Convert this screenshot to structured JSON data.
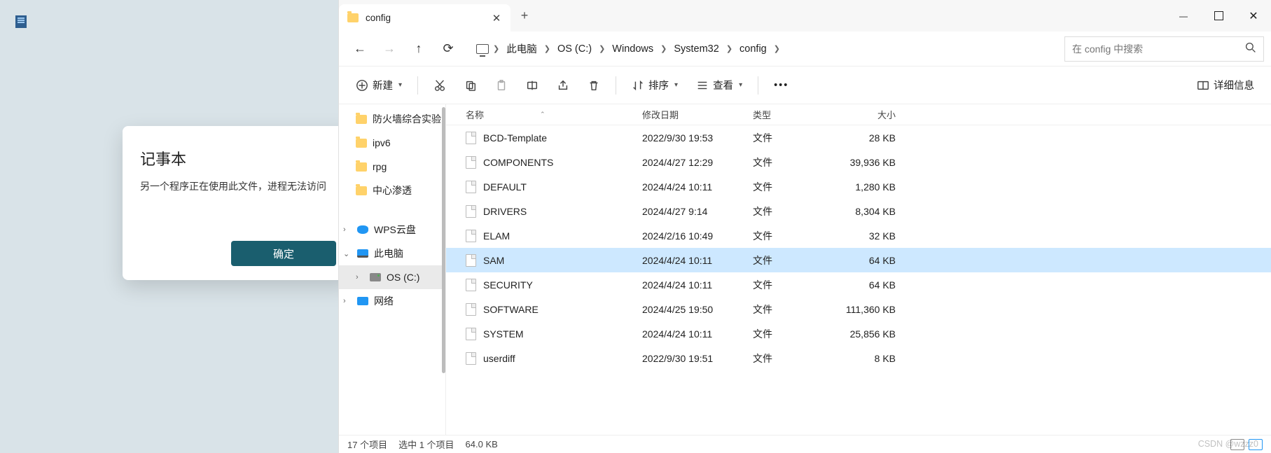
{
  "dialog": {
    "title": "记事本",
    "message": "另一个程序正在使用此文件，进程无法访问",
    "ok": "确定"
  },
  "tab": {
    "title": "config"
  },
  "breadcrumb": {
    "pc": "此电脑",
    "drive": "OS (C:)",
    "p1": "Windows",
    "p2": "System32",
    "p3": "config"
  },
  "search": {
    "placeholder": "在 config 中搜索"
  },
  "toolbar": {
    "new": "新建",
    "sort": "排序",
    "view": "查看",
    "details": "详细信息"
  },
  "nav": {
    "i0": "防火墙综合实验",
    "i1": "ipv6",
    "i2": "rpg",
    "i3": "中心渗透",
    "wps": "WPS云盘",
    "pc": "此电脑",
    "drive": "OS (C:)",
    "net": "网络"
  },
  "cols": {
    "name": "名称",
    "date": "修改日期",
    "type": "类型",
    "size": "大小"
  },
  "files": [
    {
      "n": "BCD-Template",
      "d": "2022/9/30 19:53",
      "t": "文件",
      "s": "28 KB"
    },
    {
      "n": "COMPONENTS",
      "d": "2024/4/27 12:29",
      "t": "文件",
      "s": "39,936 KB"
    },
    {
      "n": "DEFAULT",
      "d": "2024/4/24 10:11",
      "t": "文件",
      "s": "1,280 KB"
    },
    {
      "n": "DRIVERS",
      "d": "2024/4/27 9:14",
      "t": "文件",
      "s": "8,304 KB"
    },
    {
      "n": "ELAM",
      "d": "2024/2/16 10:49",
      "t": "文件",
      "s": "32 KB"
    },
    {
      "n": "SAM",
      "d": "2024/4/24 10:11",
      "t": "文件",
      "s": "64 KB"
    },
    {
      "n": "SECURITY",
      "d": "2024/4/24 10:11",
      "t": "文件",
      "s": "64 KB"
    },
    {
      "n": "SOFTWARE",
      "d": "2024/4/25 19:50",
      "t": "文件",
      "s": "111,360 KB"
    },
    {
      "n": "SYSTEM",
      "d": "2024/4/24 10:11",
      "t": "文件",
      "s": "25,856 KB"
    },
    {
      "n": "userdiff",
      "d": "2022/9/30 19:51",
      "t": "文件",
      "s": "8 KB"
    }
  ],
  "status": {
    "total": "17 个项目",
    "sel": "选中 1 个项目",
    "size": "64.0 KB"
  },
  "watermark": "CSDN @wzzz0",
  "selected_index": 5
}
